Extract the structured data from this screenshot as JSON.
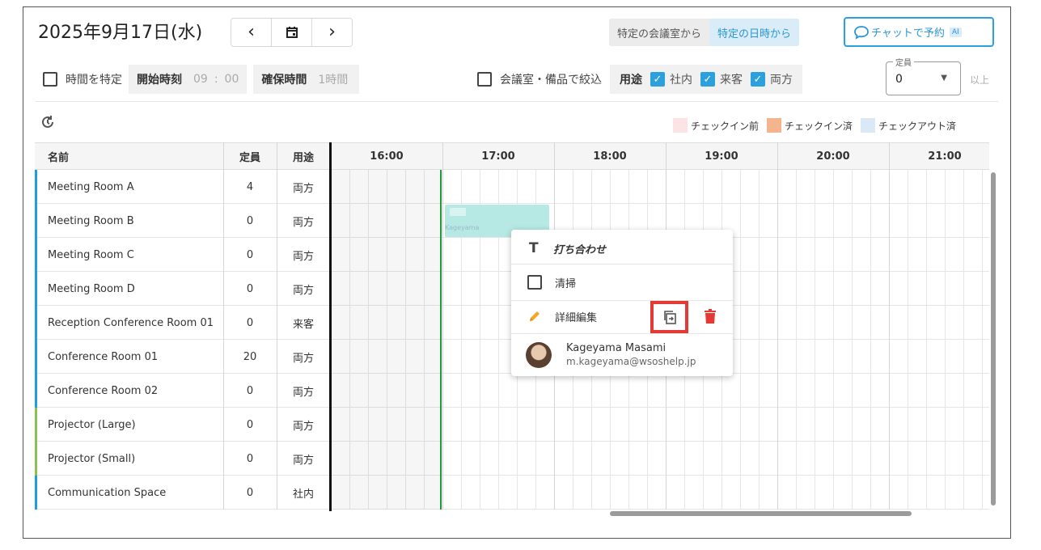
{
  "header": {
    "date": "2025年9月17日(水)",
    "prev": "‹",
    "calendar_icon": "calendar-icon",
    "next": "›",
    "mode_room": "特定の会議室から",
    "mode_datetime": "特定の日時から",
    "chat_label": "チャットで予約",
    "chat_ai": "AI"
  },
  "filters": {
    "time_check_label": "時間を特定",
    "start_label": "開始時刻",
    "start_hour": "09",
    "colon": ":",
    "start_min": "00",
    "duration_label": "確保時間",
    "duration_value": "1時間",
    "room_filter_label": "会議室・備品で絞込",
    "usage_label": "用途",
    "usage_internal": "社内",
    "usage_guest": "来客",
    "usage_both": "両方",
    "capacity_legend": "定員",
    "capacity_value": "0",
    "capacity_suffix": "以上"
  },
  "legend": {
    "before": "チェックイン前",
    "checked_in": "チェックイン済",
    "checked_out": "チェックアウト済",
    "colors": {
      "before": "#fbe3e6",
      "checked_in": "#f4b48e",
      "checked_out": "#dbe9f6"
    }
  },
  "table": {
    "headers": {
      "name": "名前",
      "capacity": "定員",
      "usage": "用途"
    },
    "hours": [
      "16:00",
      "17:00",
      "18:00",
      "19:00",
      "20:00",
      "21:00"
    ],
    "rows": [
      {
        "name": "Meeting Room A",
        "capacity": "4",
        "usage": "両方",
        "accent": "#1aa0e0"
      },
      {
        "name": "Meeting Room B",
        "capacity": "0",
        "usage": "両方",
        "accent": "#1aa0e0"
      },
      {
        "name": "Meeting Room C",
        "capacity": "0",
        "usage": "両方",
        "accent": "#1aa0e0"
      },
      {
        "name": "Meeting Room D",
        "capacity": "0",
        "usage": "両方",
        "accent": "#1aa0e0"
      },
      {
        "name": "Reception Conference Room 01",
        "capacity": "0",
        "usage": "来客",
        "accent": "#1aa0e0"
      },
      {
        "name": "Conference Room 01",
        "capacity": "20",
        "usage": "両方",
        "accent": "#1aa0e0"
      },
      {
        "name": "Conference Room 02",
        "capacity": "0",
        "usage": "両方",
        "accent": "#1aa0e0"
      },
      {
        "name": "Projector (Large)",
        "capacity": "0",
        "usage": "両方",
        "accent": "#8cc152"
      },
      {
        "name": "Projector (Small)",
        "capacity": "0",
        "usage": "両方",
        "accent": "#8cc152"
      },
      {
        "name": "Communication Space",
        "capacity": "0",
        "usage": "社内",
        "accent": "#1aa0e0"
      }
    ]
  },
  "booking": {
    "small_label": "Kageyama",
    "color": "#b6e8e4"
  },
  "popup": {
    "title": "打ち合わせ",
    "title_icon": "text-T-icon",
    "task": "清掃",
    "edit": "詳細編集",
    "edit_icon": "pencil-icon",
    "copy_icon": "copy-icon",
    "delete_icon": "trash-icon",
    "user_name": "Kageyama Masami",
    "user_email": "m.kageyama@wsoshelp.jp"
  }
}
